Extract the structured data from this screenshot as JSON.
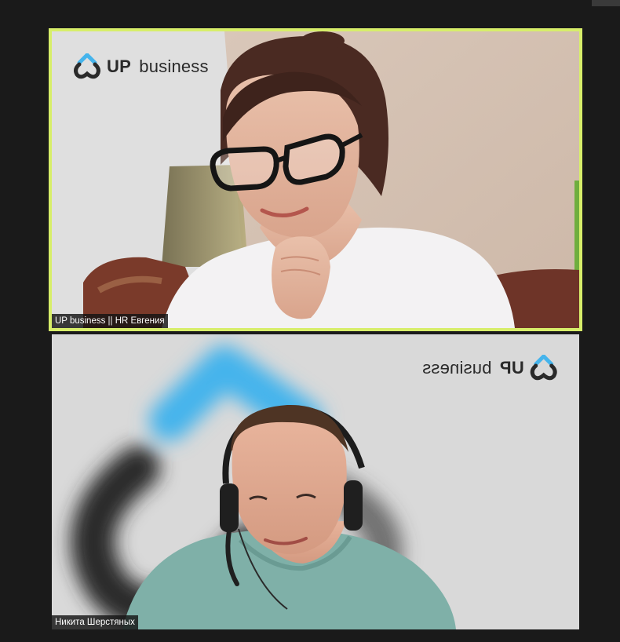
{
  "participants": [
    {
      "name": "UP business || HR Евгения",
      "active_speaker": true,
      "background_logo": {
        "bold": "UP",
        "light": "business"
      }
    },
    {
      "name": "Никита Шерстяных",
      "active_speaker": false,
      "background_logo": {
        "bold": "UP",
        "light": "business"
      }
    }
  ],
  "colors": {
    "app_background": "#1a1a1a",
    "active_speaker_border": "#d7ee6a",
    "logo_blue": "#45b4ec",
    "logo_dark": "#2a2a2a"
  },
  "icons": [
    "up-business-logo-icon",
    "participant-video-feed"
  ]
}
